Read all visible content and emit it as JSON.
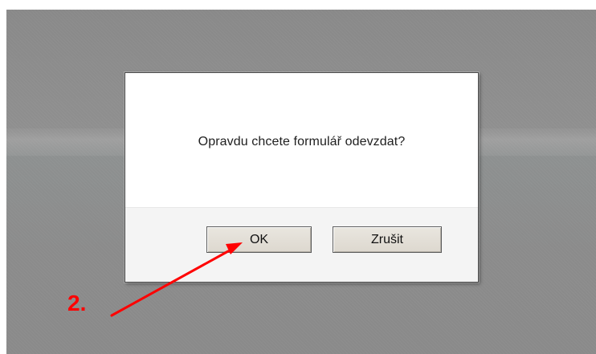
{
  "dialog": {
    "message": "Opravdu chcete formulář odevzdat?",
    "ok_label": "OK",
    "cancel_label": "Zrušit"
  },
  "annotation": {
    "step_label": "2.",
    "color": "#ff0000"
  },
  "colors": {
    "backdrop": "#8c8c8c",
    "dialog_background": "#ffffff",
    "footer_background": "#f4f4f4",
    "button_background": "#e4e0d8"
  },
  "icons": {
    "annotation_arrow": "red-arrow-icon"
  }
}
